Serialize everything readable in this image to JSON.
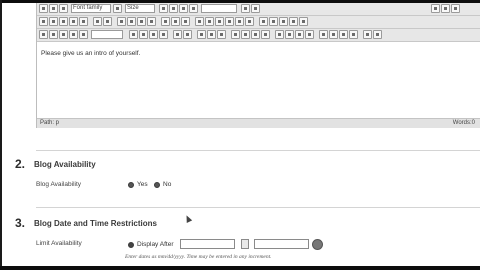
{
  "editor": {
    "font_select": "Font family",
    "size_select": "Size",
    "content": "Please give us an intro of yourself.",
    "path": "Path: p",
    "words": "Words:0"
  },
  "sections": [
    {
      "number": "2.",
      "title": "Blog Availability",
      "field_label": "Blog Availability",
      "options": [
        "Yes",
        "No"
      ]
    },
    {
      "number": "3.",
      "title": "Blog Date and Time Restrictions",
      "field_label": "Limit Availability",
      "option": "Display After",
      "hint": "Enter dates as mm/dd/yyyy. Time may be entered in any increment."
    }
  ],
  "colors": {
    "toolbar_bg": "#e7e7e7",
    "divider": "#d4d4d4",
    "radio": "#555555"
  }
}
